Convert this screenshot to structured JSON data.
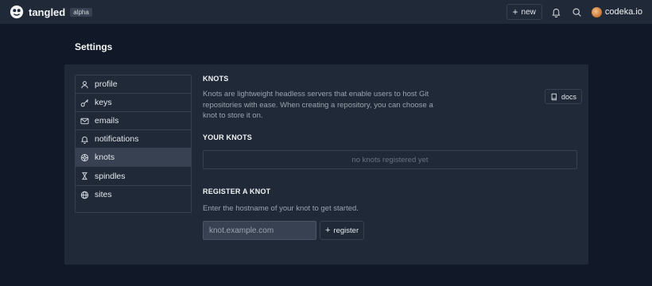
{
  "app": {
    "name": "tangled",
    "badge": "alpha"
  },
  "topbar": {
    "new_label": "new",
    "notifications_icon": "bell-icon",
    "search_icon": "search-icon",
    "username": "codeka.io"
  },
  "page": {
    "title": "Settings"
  },
  "sidebar": {
    "items": [
      {
        "label": "profile",
        "icon": "user-icon",
        "active": false
      },
      {
        "label": "keys",
        "icon": "key-icon",
        "active": false
      },
      {
        "label": "emails",
        "icon": "mail-icon",
        "active": false
      },
      {
        "label": "notifications",
        "icon": "bell-icon",
        "active": false
      },
      {
        "label": "knots",
        "icon": "knot-icon",
        "active": true
      },
      {
        "label": "spindles",
        "icon": "spindle-icon",
        "active": false
      },
      {
        "label": "sites",
        "icon": "globe-icon",
        "active": false
      }
    ]
  },
  "knots": {
    "heading": "KNOTS",
    "description": "Knots are lightweight headless servers that enable users to host Git repositories with ease. When creating a repository, you can choose a knot to store it on.",
    "docs_label": "docs",
    "your_knots_heading": "YOUR KNOTS",
    "empty_text": "no knots registered yet",
    "register_heading": "REGISTER A KNOT",
    "register_description": "Enter the hostname of your knot to get started.",
    "hostname_placeholder": "knot.example.com",
    "hostname_value": "",
    "register_label": "register"
  },
  "colors": {
    "background": "#111827",
    "surface": "#1f2937",
    "border": "#374151",
    "active_item": "#374151",
    "text_primary": "#f3f4f6",
    "text_muted": "#9ca3af"
  }
}
